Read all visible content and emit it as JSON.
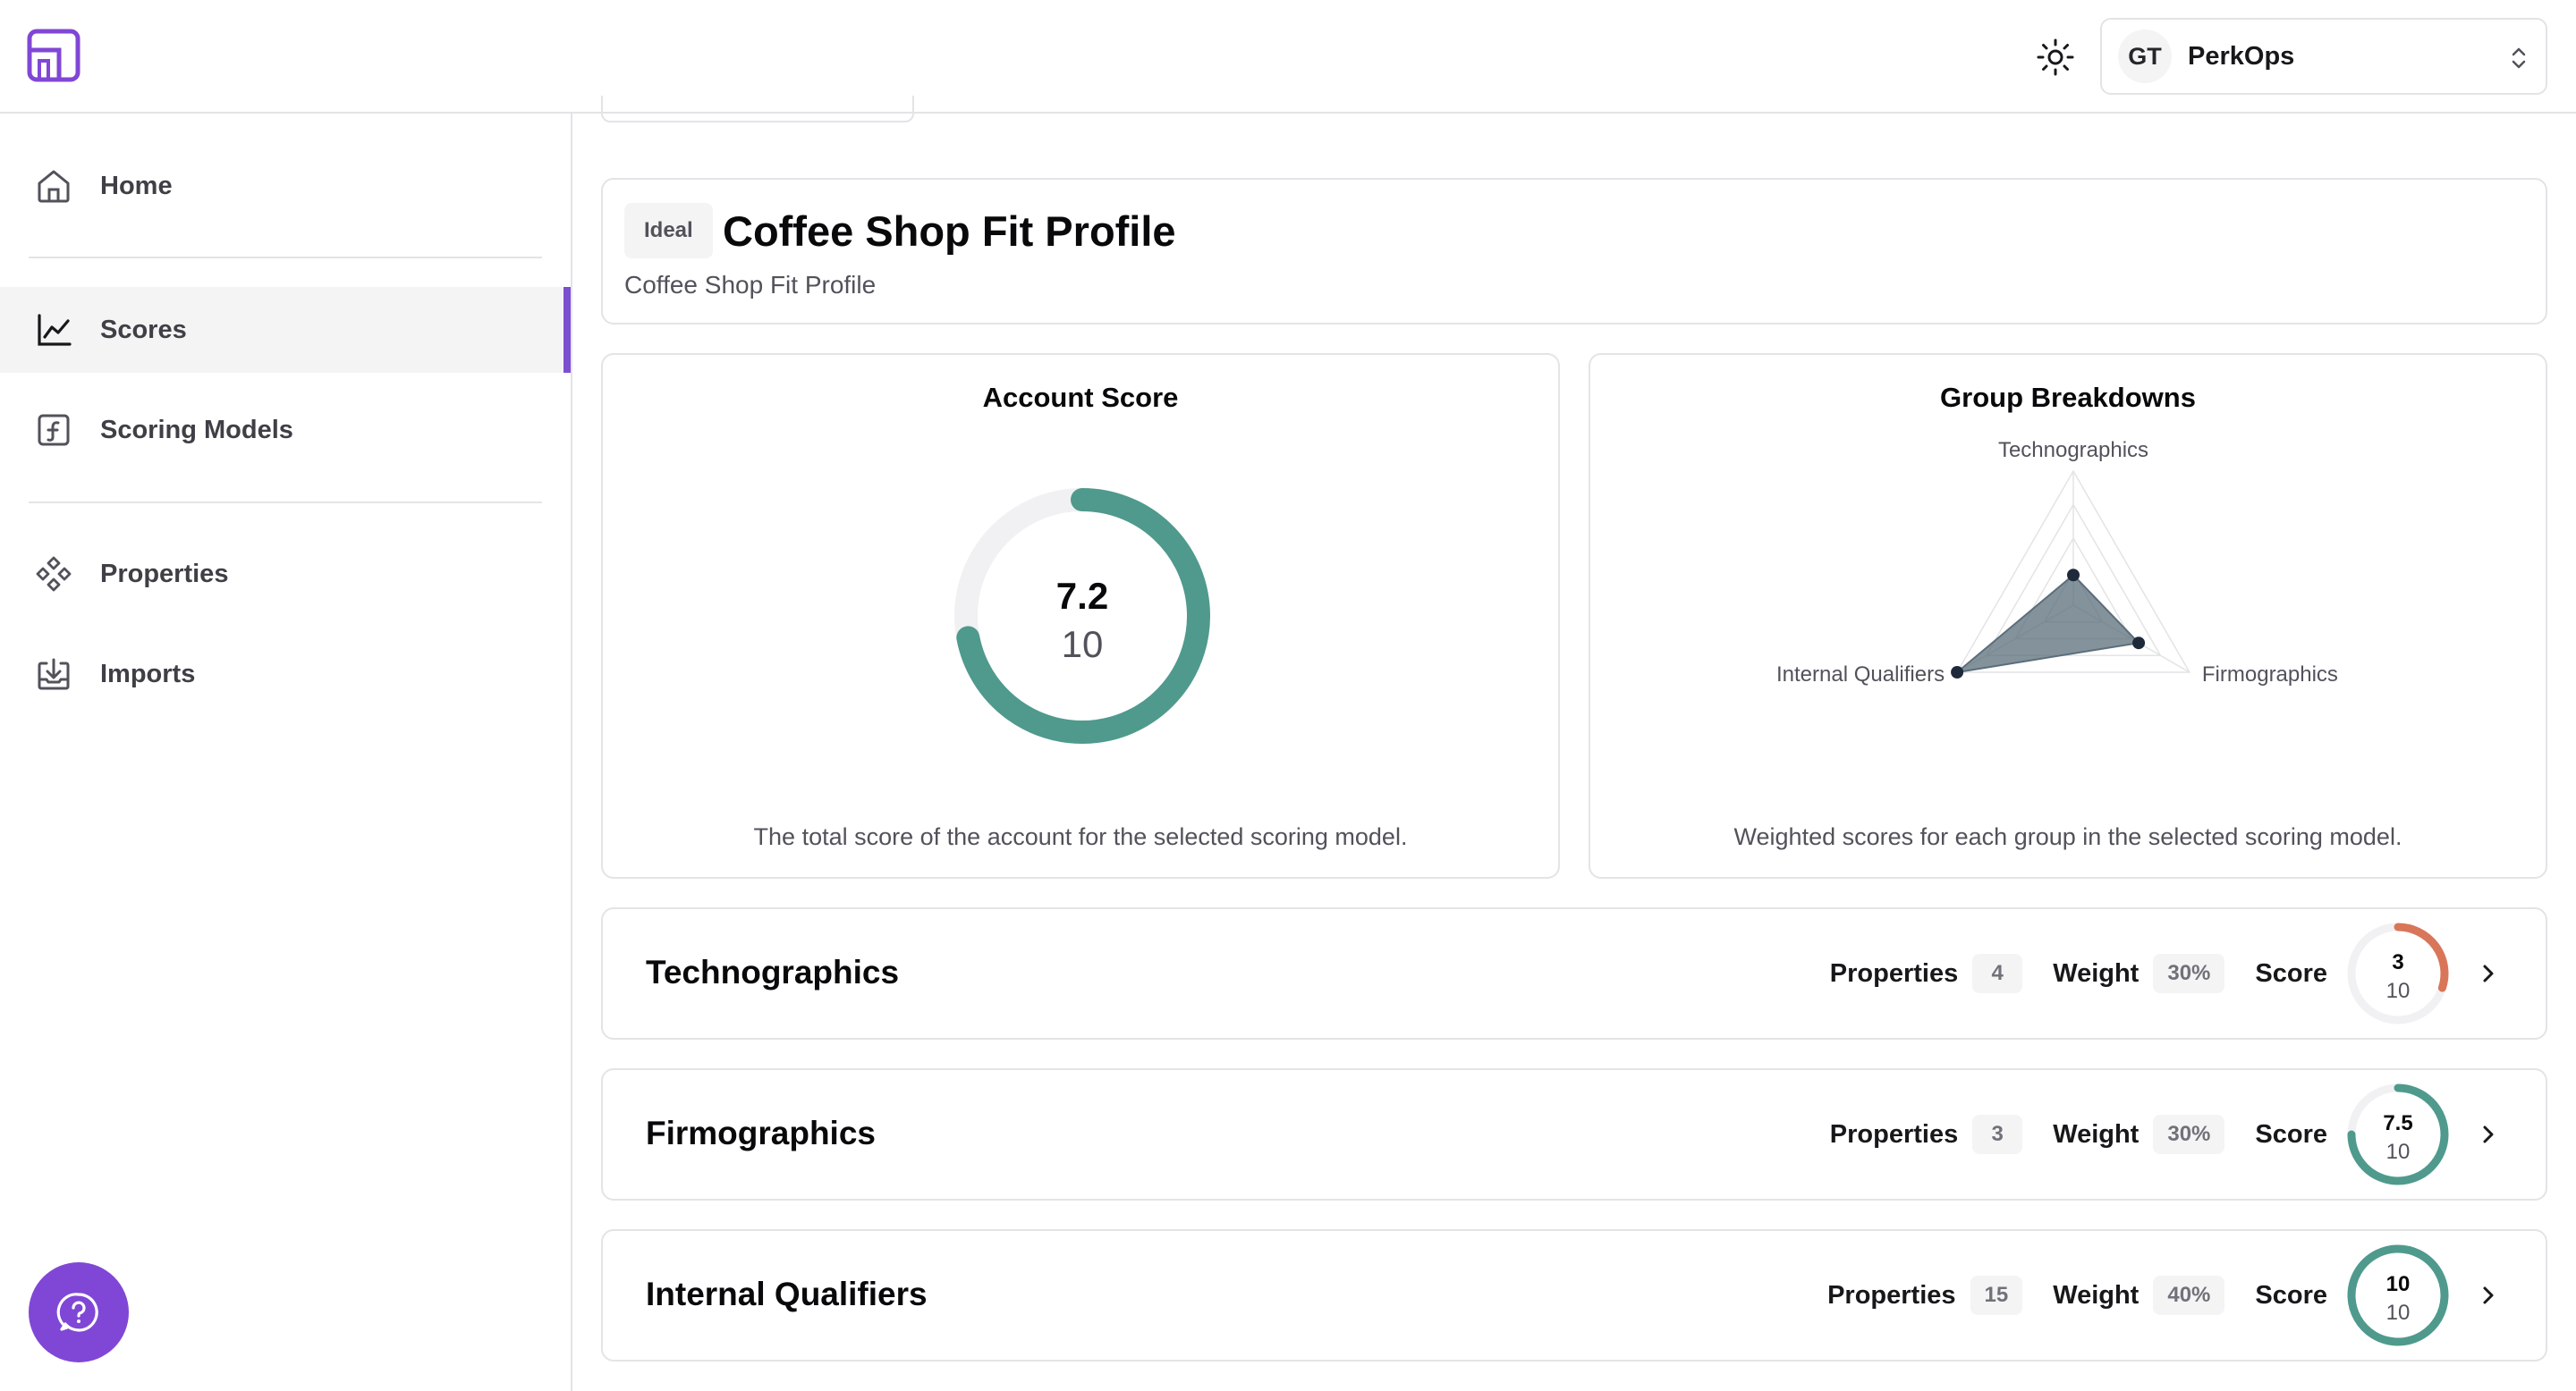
{
  "workspace": {
    "initials": "GT",
    "name": "PerkOps"
  },
  "sidebar": {
    "items": [
      {
        "label": "Home",
        "icon": "home-icon"
      },
      {
        "label": "Scores",
        "icon": "chart-line-icon",
        "active": true
      },
      {
        "label": "Scoring Models",
        "icon": "function-icon"
      },
      {
        "label": "Properties",
        "icon": "components-icon"
      },
      {
        "label": "Imports",
        "icon": "import-icon"
      }
    ]
  },
  "profile": {
    "badge": "Ideal",
    "title": "Coffee Shop Fit Profile",
    "subtitle": "Coffee Shop Fit Profile"
  },
  "account_score": {
    "title": "Account Score",
    "score": "7.2",
    "max": "10",
    "score_value": 7.2,
    "max_value": 10,
    "caption": "The total score of the account for the selected scoring model.",
    "color": "#4f9a8d"
  },
  "group_breakdowns": {
    "title": "Group Breakdowns",
    "caption": "Weighted scores for each group in the selected scoring model."
  },
  "chart_data": {
    "type": "radar",
    "axes": [
      "Technographics",
      "Firmographics",
      "Internal Qualifiers"
    ],
    "values": [
      0.9,
      2.25,
      4.0
    ],
    "range": [
      0,
      4
    ],
    "fill_color": "#5b6e7a"
  },
  "groups": [
    {
      "name": "Technographics",
      "properties_label": "Properties",
      "properties": "4",
      "weight_label": "Weight",
      "weight": "30%",
      "score_label": "Score",
      "score": "3",
      "max": "10",
      "score_value": 3,
      "color": "#d9765a"
    },
    {
      "name": "Firmographics",
      "properties_label": "Properties",
      "properties": "3",
      "weight_label": "Weight",
      "weight": "30%",
      "score_label": "Score",
      "score": "7.5",
      "max": "10",
      "score_value": 7.5,
      "color": "#4f9a8d"
    },
    {
      "name": "Internal Qualifiers",
      "properties_label": "Properties",
      "properties": "15",
      "weight_label": "Weight",
      "weight": "40%",
      "score_label": "Score",
      "score": "10",
      "max": "10",
      "score_value": 10,
      "color": "#4f9a8d"
    }
  ],
  "colors": {
    "accent": "#7c4fd1",
    "help": "#8047d6",
    "track": "#f1f1f3"
  }
}
